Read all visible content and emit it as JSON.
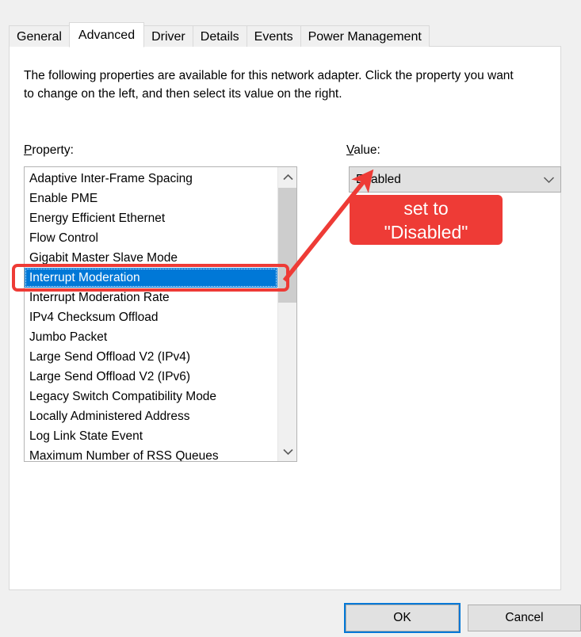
{
  "dialog": {
    "tabs": [
      {
        "label": "General",
        "active": false
      },
      {
        "label": "Advanced",
        "active": true
      },
      {
        "label": "Driver",
        "active": false
      },
      {
        "label": "Details",
        "active": false
      },
      {
        "label": "Events",
        "active": false
      },
      {
        "label": "Power Management",
        "active": false
      }
    ],
    "description": "The following properties are available for this network adapter. Click the property you want to change on the left, and then select its value on the right.",
    "property_label_accel": "P",
    "property_label_rest": "roperty:",
    "value_label_accel": "V",
    "value_label_rest": "alue:",
    "property_list": [
      "Adaptive Inter-Frame Spacing",
      "Enable PME",
      "Energy Efficient Ethernet",
      "Flow Control",
      "Gigabit Master Slave Mode",
      "Interrupt Moderation",
      "Interrupt Moderation Rate",
      "IPv4 Checksum Offload",
      "Jumbo Packet",
      "Large Send Offload V2 (IPv4)",
      "Large Send Offload V2 (IPv6)",
      "Legacy Switch Compatibility Mode",
      "Locally Administered Address",
      "Log Link State Event",
      "Maximum Number of RSS Queues"
    ],
    "selected_property": "Interrupt Moderation",
    "value": {
      "selected": "Enabled",
      "chevron_icon": "chevron-down-icon"
    },
    "scrollbar": {
      "up_icon": "chevron-up-icon",
      "down_icon": "chevron-down-icon"
    },
    "buttons": {
      "ok": "OK",
      "cancel": "Cancel"
    }
  },
  "annotation": {
    "line1": "set to",
    "line2": "\"Disabled\"",
    "color": "#ee3b36",
    "text_color": "#ffffff",
    "highlight_target": "Interrupt Moderation",
    "arrow_icon": "arrow-up-right-icon"
  },
  "colors": {
    "selection_blue": "#0078d7",
    "dialog_background": "#f0f0f0",
    "panel_background": "#ffffff",
    "annotation_red": "#ee3b36",
    "focus_ring": "#0078d7"
  }
}
